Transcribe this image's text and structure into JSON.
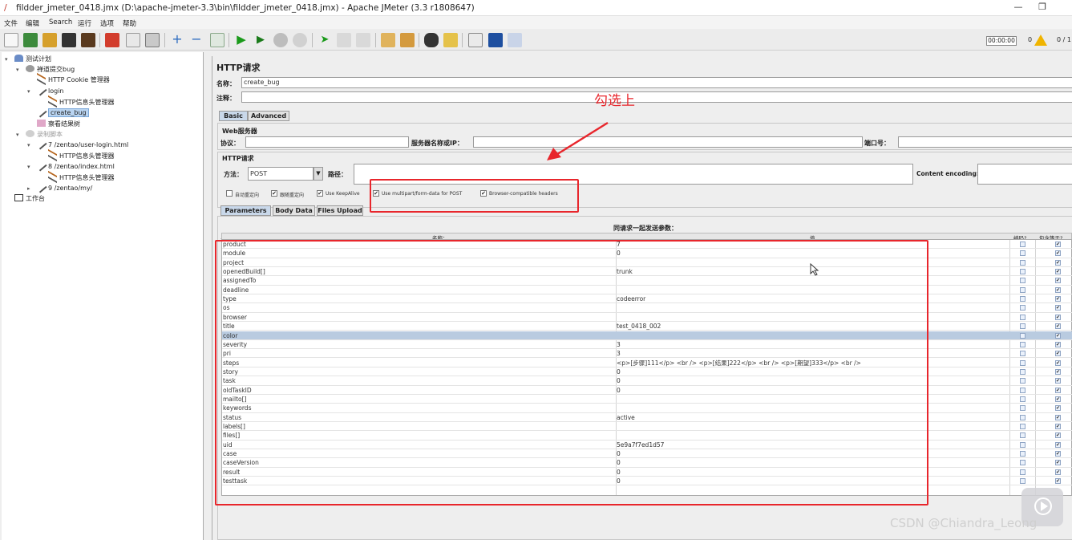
{
  "window": {
    "title": "fildder_jmeter_0418.jmx (D:\\apache-jmeter-3.3\\bin\\fildder_jmeter_0418.jmx) - Apache JMeter (3.3 r1808647)",
    "minimize": "—",
    "restore": "❐"
  },
  "menu": [
    "文件",
    "编辑",
    "Search",
    "运行",
    "选项",
    "帮助"
  ],
  "status": {
    "timer": "00:00:00",
    "errors": "0",
    "ratio": "0 / 1"
  },
  "tree": {
    "nodes": [
      {
        "label": "测试计划"
      },
      {
        "label": "禅道提交bug"
      },
      {
        "label": "HTTP Cookie 管理器"
      },
      {
        "label": "login"
      },
      {
        "label": "HTTP信息头管理器"
      },
      {
        "label": "create_bug"
      },
      {
        "label": "察看结果树"
      },
      {
        "label": "录制脚本"
      },
      {
        "label": "7 /zentao/user-login.html"
      },
      {
        "label": "HTTP信息头管理器"
      },
      {
        "label": "8 /zentao/index.html"
      },
      {
        "label": "HTTP信息头管理器"
      },
      {
        "label": "9 /zentao/my/"
      },
      {
        "label": "工作台"
      }
    ]
  },
  "panel": {
    "heading": "HTTP请求",
    "name_label": "名称：",
    "name_value": "create_bug",
    "comment_label": "注释：",
    "tabs": [
      "Basic",
      "Advanced"
    ],
    "web_server_label": "Web服务器",
    "protocol_label": "协议：",
    "server_label": "服务器名称或IP：",
    "port_label": "端口号：",
    "http_request_label": "HTTP请求",
    "method_label": "方法：",
    "method_value": "POST",
    "path_label": "路径：",
    "encoding_label": "Content encoding:",
    "checkboxes": [
      {
        "label": "自动重定向",
        "checked": false
      },
      {
        "label": "跟随重定向",
        "checked": true
      },
      {
        "label": "Use KeepAlive",
        "checked": true
      },
      {
        "label": "Use multipart/form-data for POST",
        "checked": true
      },
      {
        "label": "Browser-compatible headers",
        "checked": true
      }
    ],
    "subtabs": [
      "Parameters",
      "Body Data",
      "Files Upload"
    ],
    "params_caption": "同请求一起发送参数：",
    "col_name": "名称：",
    "col_value": "值",
    "col_encode": "编码?",
    "col_include_equals": "包含等于?"
  },
  "annotation": {
    "text": "勾选上"
  },
  "parameters": [
    {
      "name": "product",
      "value": "7"
    },
    {
      "name": "module",
      "value": "0"
    },
    {
      "name": "project",
      "value": ""
    },
    {
      "name": "openedBuild[]",
      "value": "trunk"
    },
    {
      "name": "assignedTo",
      "value": ""
    },
    {
      "name": "deadline",
      "value": ""
    },
    {
      "name": "type",
      "value": "codeerror"
    },
    {
      "name": "os",
      "value": ""
    },
    {
      "name": "browser",
      "value": ""
    },
    {
      "name": "title",
      "value": "test_0418_002"
    },
    {
      "name": "color",
      "value": "",
      "highlight": true
    },
    {
      "name": "severity",
      "value": "3"
    },
    {
      "name": "pri",
      "value": "3"
    },
    {
      "name": "steps",
      "value": "<p>[步骤]111</p> <br /> <p>[结果]222</p> <br /> <p>[期望]333</p> <br />"
    },
    {
      "name": "story",
      "value": "0"
    },
    {
      "name": "task",
      "value": "0"
    },
    {
      "name": "oldTaskID",
      "value": "0"
    },
    {
      "name": "mailto[]",
      "value": ""
    },
    {
      "name": "keywords",
      "value": ""
    },
    {
      "name": "status",
      "value": "active"
    },
    {
      "name": "labels[]",
      "value": ""
    },
    {
      "name": "files[]",
      "value": ""
    },
    {
      "name": "uid",
      "value": "5e9a7f7ed1d57"
    },
    {
      "name": "case",
      "value": "0"
    },
    {
      "name": "caseVersion",
      "value": "0"
    },
    {
      "name": "result",
      "value": "0"
    },
    {
      "name": "testtask",
      "value": "0"
    }
  ],
  "watermark": "CSDN @Chiandra_Leong",
  "colors": {
    "annotation_red": "#e8262c",
    "selection": "#b9d4f1",
    "warning": "#f0b400"
  }
}
